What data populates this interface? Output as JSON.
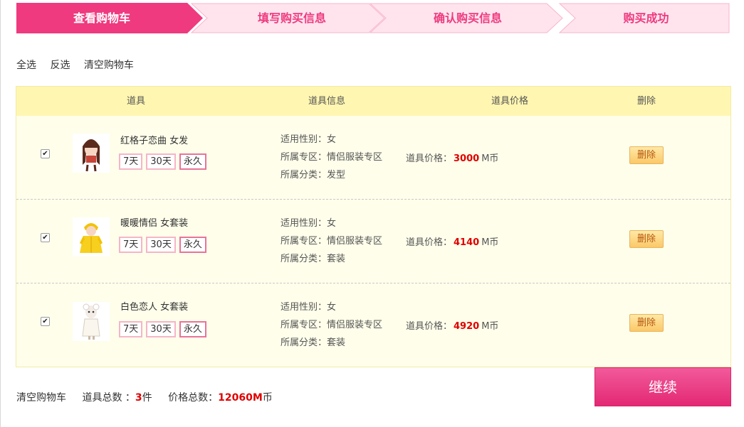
{
  "steps": [
    {
      "label": "查看购物车",
      "state": "active"
    },
    {
      "label": "填写购买信息",
      "state": "idle"
    },
    {
      "label": "确认购买信息",
      "state": "idle"
    },
    {
      "label": "购买成功",
      "state": "idle"
    }
  ],
  "colors": {
    "accent": "#ef3a7f",
    "idle_fill": "#ffe4ee",
    "idle_border": "#f8b4cc",
    "header_bg": "#fff6b1",
    "body_bg": "#fffeeb",
    "price": "#e00000"
  },
  "actions": {
    "select_all": "全选",
    "invert": "反选",
    "clear": "清空购物车"
  },
  "table": {
    "headers": {
      "item": "道具",
      "info": "道具信息",
      "price": "道具价格",
      "delete": "删除"
    }
  },
  "items": [
    {
      "checked": true,
      "image": "girl-hair-icon",
      "name": "红格子恋曲 女发",
      "durations": [
        "7天",
        "30天",
        "永久"
      ],
      "selected_duration": "永久",
      "gender": "适用性别：女",
      "zone": "所属专区：情侣服装专区",
      "category": "所属分类：发型",
      "price_label": "道具价格：",
      "price_value": "3000",
      "price_unit": "M币",
      "delete_label": "删除"
    },
    {
      "checked": true,
      "image": "yellow-raincoat-icon",
      "name": "暖暖情侣 女套装",
      "durations": [
        "7天",
        "30天",
        "永久"
      ],
      "selected_duration": "永久",
      "gender": "适用性别：女",
      "zone": "所属专区：情侣服装专区",
      "category": "所属分类：套装",
      "price_label": "道具价格：",
      "price_value": "4140",
      "price_unit": "M币",
      "delete_label": "删除"
    },
    {
      "checked": true,
      "image": "white-suit-icon",
      "name": "白色恋人 女套装",
      "durations": [
        "7天",
        "30天",
        "永久"
      ],
      "selected_duration": "永久",
      "gender": "适用性别：女",
      "zone": "所属专区：情侣服装专区",
      "category": "所属分类：套装",
      "price_label": "道具价格：",
      "price_value": "4920",
      "price_unit": "M币",
      "delete_label": "删除"
    }
  ],
  "footer": {
    "clear": "清空购物车",
    "count_label": "道具总数 ：",
    "count_value": "3",
    "count_unit": "件",
    "total_label": "价格总数：",
    "total_value": "12060M",
    "total_unit": "币"
  },
  "continue_label": "继续"
}
